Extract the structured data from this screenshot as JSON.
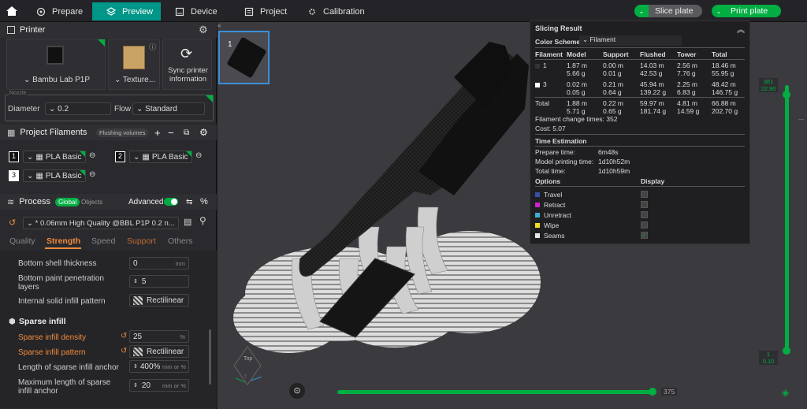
{
  "topbar": {
    "tabs": [
      {
        "label": "Prepare"
      },
      {
        "label": "Preview"
      },
      {
        "label": "Device"
      },
      {
        "label": "Project"
      },
      {
        "label": "Calibration"
      }
    ],
    "slice_label": "Slice plate",
    "print_label": "Print plate"
  },
  "printer": {
    "title": "Printer",
    "name": "Bambu Lab P1P",
    "plate": "Texture...",
    "sync": "Sync printer information",
    "nozzle_group": "Nozzle",
    "diameter_label": "Diameter",
    "diameter_value": "0.2",
    "flow_label": "Flow",
    "flow_value": "Standard"
  },
  "filaments": {
    "title": "Project Filaments",
    "flushing": "Flushing volumes",
    "items": [
      {
        "num": "1",
        "name": "PLA Basic"
      },
      {
        "num": "2",
        "name": "PLA Basic"
      },
      {
        "num": "3",
        "name": "PLA Basic"
      }
    ]
  },
  "process": {
    "title": "Process",
    "global": "Global",
    "objects": "Objects",
    "advanced": "Advanced",
    "preset": "* 0.06mm High Quality @BBL P1P 0.2 n...",
    "tabs": [
      "Quality",
      "Strength",
      "Speed",
      "Support",
      "Others"
    ],
    "params": [
      {
        "label": "Bottom shell thickness",
        "value": "0",
        "unit": "mm"
      },
      {
        "label": "Bottom paint penetration layers",
        "value": "5",
        "unit": ""
      },
      {
        "label": "Internal solid infill pattern",
        "value": "Rectilinear",
        "unit": ""
      }
    ],
    "sparse_title": "Sparse infill",
    "sparse": [
      {
        "label": "Sparse infill density",
        "value": "25",
        "unit": "%"
      },
      {
        "label": "Sparse infill pattern",
        "value": "Rectilinear",
        "unit": ""
      },
      {
        "label": "Length of sparse infill anchor",
        "value": "400%",
        "unit": "mm or %"
      },
      {
        "label": "Maximum length of sparse infill anchor",
        "value": "20",
        "unit": "mm or %"
      }
    ]
  },
  "thumb": {
    "num": "1"
  },
  "slicing": {
    "title": "Slicing Result",
    "scheme_label": "Color Scheme",
    "scheme_value": "Filament",
    "headers": [
      "Filament",
      "Model",
      "Support",
      "Flushed",
      "Tower",
      "Total"
    ],
    "rows": [
      {
        "id": "1",
        "color": "#333333",
        "c": [
          [
            "1.87 m",
            "5.66 g"
          ],
          [
            "0.00 m",
            "0.01 g"
          ],
          [
            "14.03 m",
            "42.53 g"
          ],
          [
            "2.56 m",
            "7.76 g"
          ],
          [
            "18.46 m",
            "55.95 g"
          ]
        ]
      },
      {
        "id": "3",
        "color": "#ffffff",
        "c": [
          [
            "0.02 m",
            "0.05 g"
          ],
          [
            "0.21 m",
            "0.64 g"
          ],
          [
            "45.94 m",
            "139.22 g"
          ],
          [
            "2.25 m",
            "6.83 g"
          ],
          [
            "48.42 m",
            "146.75 g"
          ]
        ]
      },
      {
        "id": "Total",
        "color": "",
        "c": [
          [
            "1.88 m",
            "5.71 g"
          ],
          [
            "0.22 m",
            "0.65 g"
          ],
          [
            "59.97 m",
            "181.74 g"
          ],
          [
            "4.81 m",
            "14.59 g"
          ],
          [
            "66.88 m",
            "202.70 g"
          ]
        ]
      }
    ],
    "change_times": "Filament change times:  352",
    "cost": "Cost:  5.07",
    "time_title": "Time Estimation",
    "times": [
      [
        "Prepare time:",
        "6m48s"
      ],
      [
        "Model printing time:",
        "1d10h52m"
      ],
      [
        "Total time:",
        "1d10h59m"
      ]
    ],
    "options_label": "Options",
    "display_label": "Display",
    "options": [
      {
        "name": "Travel",
        "color": "#3a4fa8",
        "checked": false
      },
      {
        "name": "Retract",
        "color": "#d020d0",
        "checked": false
      },
      {
        "name": "Unretract",
        "color": "#3ab0d0",
        "checked": false
      },
      {
        "name": "Wipe",
        "color": "#f0e020",
        "checked": false
      },
      {
        "name": "Seams",
        "color": "#e8e8e8",
        "checked": true
      }
    ]
  },
  "layer": {
    "top_layer": "381",
    "top_z": "22.90",
    "bottom_layer": "1",
    "bottom_z": "0.10",
    "move_value": "375"
  },
  "colors": {
    "accent": "#00ae42",
    "preview_tab": "#009688"
  }
}
